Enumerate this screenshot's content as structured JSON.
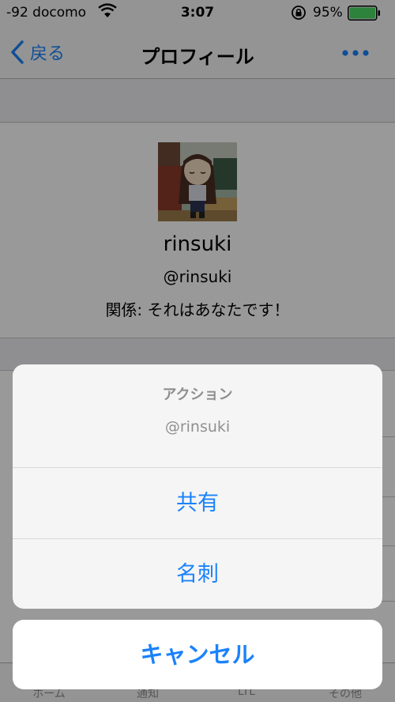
{
  "status_bar": {
    "carrier": "-92 docomo",
    "time": "3:07",
    "battery": "95%",
    "wifi_icon": "wifi-icon",
    "lock_icon": "rotation-lock-icon",
    "battery_level": 0.95,
    "battery_color": "#4cd964"
  },
  "nav": {
    "back_label": "戻る",
    "title": "プロフィール",
    "more_icon": "ellipsis-icon"
  },
  "profile": {
    "name": "rinsuki",
    "handle": "@rinsuki",
    "relation": "関係: それはあなたです！"
  },
  "tabs": [
    "ホーム",
    "通知",
    "LTL",
    "その他"
  ],
  "action_sheet": {
    "title": "アクション",
    "message": "@rinsuki",
    "actions": [
      "共有",
      "名刺"
    ],
    "cancel": "キャンセル"
  },
  "colors": {
    "accent": "#1a82fb"
  }
}
